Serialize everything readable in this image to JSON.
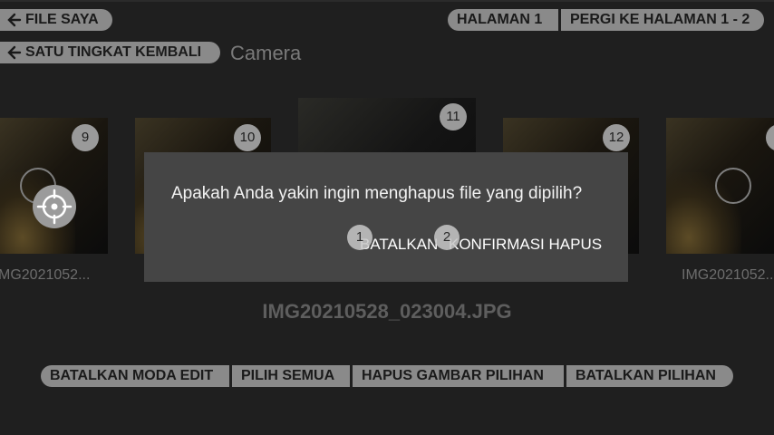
{
  "nav": {
    "back_to_files": "FILE SAYA",
    "up_one_level": "SATU TINGKAT KEMBALI",
    "folder_name": "Camera"
  },
  "pager": {
    "page_label": "HALAMAN 1",
    "goto_label": "PERGI KE HALAMAN 1 - 2"
  },
  "thumbnails": [
    {
      "badge": "9",
      "caption": "MG2021052...",
      "selectable": true
    },
    {
      "badge": "10",
      "caption": "",
      "selectable": false
    },
    {
      "badge": "11",
      "caption": "",
      "selectable": false
    },
    {
      "badge": "12",
      "caption": "",
      "selectable": false
    },
    {
      "badge": "",
      "caption": "IMG2021052...",
      "selectable": true
    }
  ],
  "current_file": "IMG20210528_023004.JPG",
  "dialog": {
    "message": "Apakah Anda yakin ingin menghapus file yang dipilih?",
    "cancel_label": "BATALKAN",
    "confirm_label": "KONFIRMASI HAPUS"
  },
  "overlay_markers": [
    "1",
    "2"
  ],
  "toolbar": {
    "cancel_edit": "BATALKAN MODA EDIT",
    "select_all": "PILIH SEMUA",
    "delete_selected": "HAPUS GAMBAR PILIHAN",
    "cancel_selection": "BATALKAN PILIHAN"
  },
  "icons": {
    "back": "arrow-left-icon",
    "crosshair": "crosshair-icon"
  },
  "colors": {
    "background": "#1f1f1f",
    "pill": "#8a8a8a",
    "dialog": "#454545",
    "dialog_text": "#f2f2f2"
  }
}
